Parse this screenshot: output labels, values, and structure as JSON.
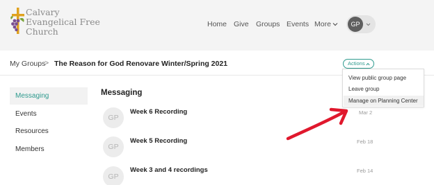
{
  "logo": {
    "line1": "Calvary",
    "line2": "Evangelical Free",
    "line3": "Church",
    "colors": {
      "cross": "#e0a21f",
      "grapes": "#7a4e8f",
      "leaves": "#7aa43a"
    }
  },
  "nav": {
    "items": [
      "Home",
      "Give",
      "Groups",
      "Events",
      "More"
    ],
    "avatar_initials": "GP"
  },
  "breadcrumb": {
    "root": "My Groups",
    "separator": ">",
    "current": "The Reason for God Renovare Winter/Spring 2021"
  },
  "actions": {
    "label": "Actions",
    "menu": [
      "View public group page",
      "Leave group",
      "Manage on Planning Center"
    ],
    "highlighted_item": "Manage on Planning Center"
  },
  "sidebar": {
    "items": [
      "Messaging",
      "Events",
      "Resources",
      "Members"
    ],
    "active": "Messaging"
  },
  "main": {
    "title": "Messaging",
    "messages": [
      {
        "avatar": "GP",
        "title": "Week 6 Recording",
        "date": "Mar 2"
      },
      {
        "avatar": "GP",
        "title": "Week 5 Recording",
        "date": "Feb 18"
      },
      {
        "avatar": "GP",
        "title": "Week 3 and 4 recordings",
        "date": "Feb 14"
      }
    ]
  },
  "colors": {
    "accent": "#2e9a8e",
    "annotation_arrow": "#e0182d"
  }
}
